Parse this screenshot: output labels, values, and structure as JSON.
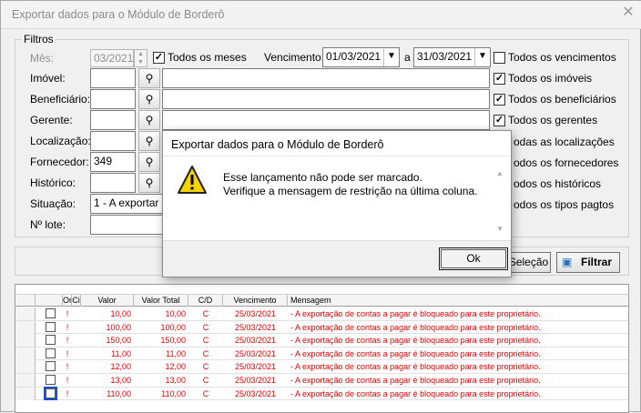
{
  "window": {
    "title": "Exportar dados para o Módulo de Borderô",
    "close_glyph": "✕"
  },
  "filters": {
    "legend": "Filtros",
    "mes": {
      "label": "Mês:",
      "value": "03/2021"
    },
    "todos_meses": {
      "label": "Todos os meses",
      "checked": true
    },
    "vencimento": {
      "label": "Vencimento:",
      "from": "01/03/2021",
      "sep": "a",
      "to": "31/03/2021"
    },
    "todos_vencimentos": {
      "label": "Todos os vencimentos",
      "checked": false
    },
    "rows": [
      {
        "label": "Imóvel:",
        "code": "",
        "check_label": "Todos os imóveis",
        "checked": true
      },
      {
        "label": "Beneficiário:",
        "code": "",
        "check_label": "Todos os beneficiários",
        "checked": true
      },
      {
        "label": "Gerente:",
        "code": "",
        "check_label": "Todos os gerentes",
        "checked": true
      },
      {
        "label": "Localização:",
        "code": "",
        "check_label": "odas as localizações"
      },
      {
        "label": "Fornecedor:",
        "code": "349",
        "check_label": "odos os fornecedores"
      },
      {
        "label": "Histórico:",
        "code": "",
        "check_label": "odos os históricos"
      }
    ],
    "situacao": {
      "label": "Situação:",
      "value": "1 - A exportar",
      "check_label": "odos os tipos pagtos"
    },
    "lote": {
      "label": "Nº lote:",
      "value": ""
    }
  },
  "actions": {
    "selecao_label": "Seleção",
    "filtrar_label": "Filtrar"
  },
  "grid": {
    "headers": [
      "",
      "",
      "On",
      "Ci",
      "Valor",
      "Valor Total",
      "C/D",
      "Vencimento",
      "Mensagem"
    ],
    "rows": [
      {
        "valor": "10,00",
        "total": "10,00",
        "cd": "C",
        "venc": "25/03/2021",
        "msg": "- A exportação de contas a pagar é bloqueado para este proprietário."
      },
      {
        "valor": "100,00",
        "total": "100,00",
        "cd": "C",
        "venc": "25/03/2021",
        "msg": "- A exportação de contas a pagar é bloqueado para este proprietário."
      },
      {
        "valor": "150,00",
        "total": "150,00",
        "cd": "C",
        "venc": "25/03/2021",
        "msg": "- A exportação de contas a pagar é bloqueado para este proprietário."
      },
      {
        "valor": "11,00",
        "total": "11,00",
        "cd": "C",
        "venc": "25/03/2021",
        "msg": "- A exportação de contas a pagar é bloqueado para este proprietário."
      },
      {
        "valor": "12,00",
        "total": "12,00",
        "cd": "C",
        "venc": "25/03/2021",
        "msg": "- A exportação de contas a pagar é bloqueado para este proprietário."
      },
      {
        "valor": "13,00",
        "total": "13,00",
        "cd": "C",
        "venc": "25/03/2021",
        "msg": "- A exportação de contas a pagar é bloqueado para este proprietário."
      },
      {
        "valor": "110,00",
        "total": "110,00",
        "cd": "C",
        "venc": "25/03/2021",
        "msg": "- A exportação de contas a pagar é bloqueado para este proprietário."
      }
    ]
  },
  "modal": {
    "title": "Exportar dados para o Módulo de Borderô",
    "line1": "Esse lançamento não pode ser marcado.",
    "line2": "Verifique a mensagem de restrição na última coluna.",
    "ok_label": "Ok",
    "icon": "warning-icon"
  },
  "colors": {
    "error_text": "#e00000",
    "warning_yellow": "#f5d200"
  }
}
